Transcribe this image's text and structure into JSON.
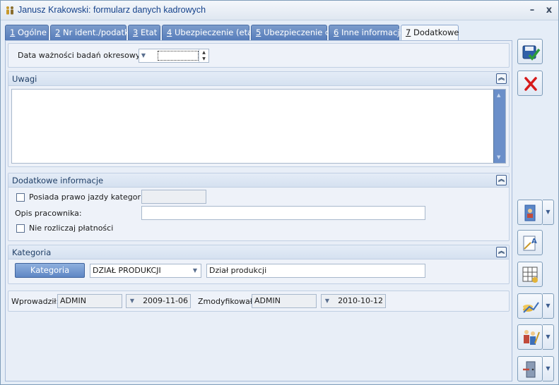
{
  "window": {
    "title": "Janusz Krakowski: formularz danych kadrowych",
    "minimize_label": "–",
    "close_label": "x"
  },
  "tabs": [
    {
      "num": "1",
      "label": " Ogólne"
    },
    {
      "num": "2",
      "label": " Nr ident./podatki"
    },
    {
      "num": "3",
      "label": " Etat"
    },
    {
      "num": "4",
      "label": " Ubezpieczenie (etat)"
    },
    {
      "num": "5",
      "label": " Ubezpieczenie cd"
    },
    {
      "num": "6",
      "label": " Inne informacje"
    },
    {
      "num": "7",
      "label": " Dodatkowe"
    }
  ],
  "badania": {
    "label": "Data ważności badań okresowych:",
    "value": ""
  },
  "uwagi": {
    "title": "Uwagi",
    "text": ""
  },
  "dodatkowe": {
    "title": "Dodatkowe informacje",
    "prawo_jazdy_label": "Posiada prawo jazdy kategorii:",
    "prawo_jazdy_value": "",
    "opis_label": "Opis pracownika:",
    "opis_value": "",
    "nie_rozliczaj_label": "Nie rozliczaj płatności"
  },
  "kategoria": {
    "title": "Kategoria",
    "button_label": "Kategoria",
    "code": "DZIAŁ PRODUKCJI",
    "description": "Dział produkcji"
  },
  "audit": {
    "wprowadzil_label": "Wprowadził:",
    "wprowadzil_user": "ADMIN",
    "wprowadzil_date": "2009-11-06",
    "zmodyfikowal_label": "Zmodyfikował:",
    "zmodyfikowal_user": "ADMIN",
    "zmodyfikowal_date": "2010-10-12"
  },
  "collapse_glyph": "︽",
  "dropdown_glyph": "▼",
  "colors": {
    "accent": "#5e86c4",
    "save_green": "#2e9e3a",
    "cancel_red": "#d61a1a"
  }
}
